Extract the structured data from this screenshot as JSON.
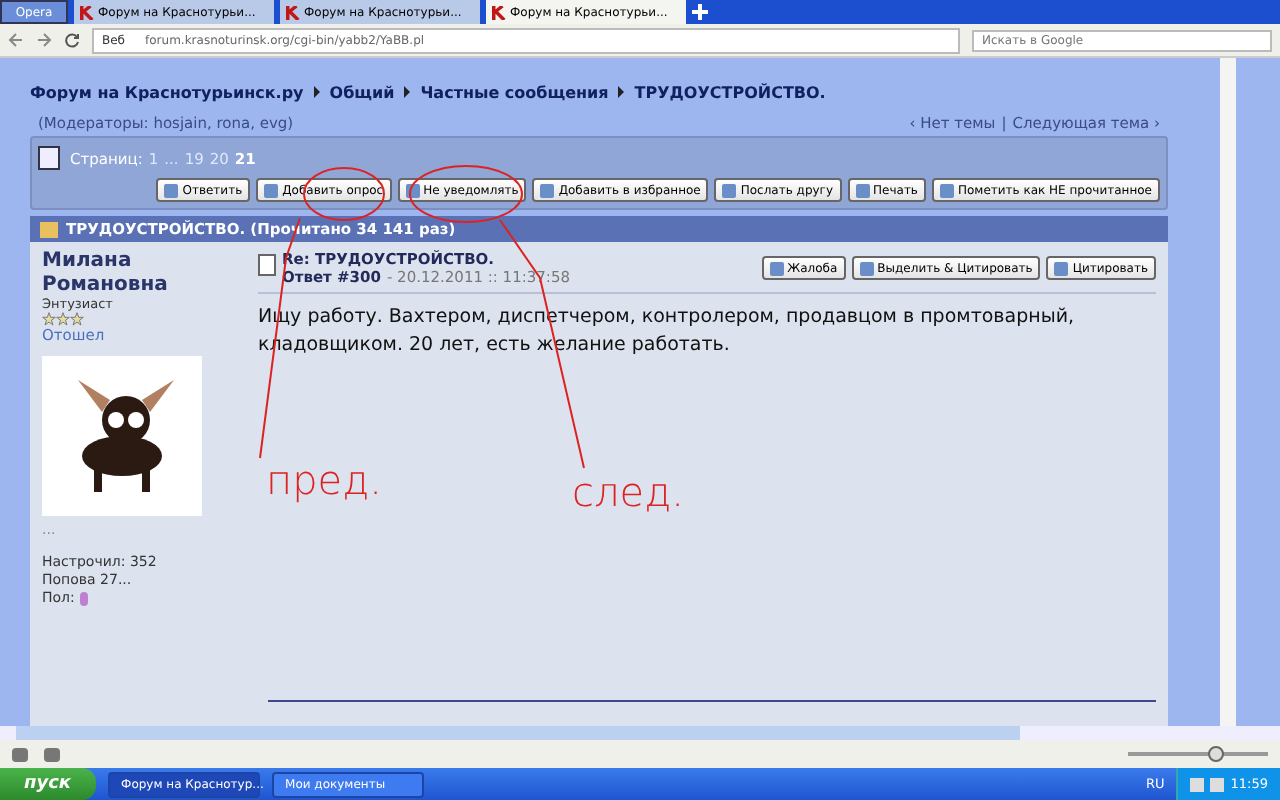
{
  "browser": {
    "app_button": "Opera",
    "tabs": [
      {
        "label": "Форум на Краснотурьи...",
        "selected": false
      },
      {
        "label": "Форум на Краснотурьи...",
        "selected": false
      },
      {
        "label": "Форум на Краснотурьи...",
        "selected": true
      }
    ],
    "address": {
      "prefix": "Веб",
      "url": "forum.krasnoturinsk.org/cgi-bin/yabb2/YaBB.pl"
    },
    "search": {
      "placeholder": "Искать в Google"
    }
  },
  "page": {
    "breadcrumbs": [
      "Форум на Краснотурьинск.ру",
      "Общий",
      "Частные сообщения",
      "ТРУДОУСТРОЙСТВО."
    ],
    "moderators": "(Модераторы: hosjain, rona, evg)",
    "topic_nav": [
      {
        "label": "‹ Нет темы"
      },
      {
        "label": "Следующая тема ›"
      }
    ],
    "topic_nav_separator": "|",
    "pages": {
      "label": "Страниц:",
      "items": [
        {
          "label": "1",
          "selected": false
        },
        {
          "label": "...",
          "selected": false
        },
        {
          "label": "19",
          "selected": false
        },
        {
          "label": "20",
          "selected": false
        },
        {
          "label": "21",
          "selected": true
        }
      ]
    },
    "toolbar": [
      "Ответить",
      "Добавить опрос",
      "Не уведомлять",
      "Добавить в избранное",
      "Послать другу",
      "Печать",
      "Пометить как НЕ прочитанное"
    ],
    "topic_header": "ТРУДОУСТРОЙСТВО. (Прочитано 34 141 раз)",
    "post": {
      "author": {
        "name": "Милана Романовна",
        "rank": "Энтузиаст",
        "stars": 3,
        "status": "Отошел",
        "ellipsis": "...",
        "stats": [
          "Настрочил: 352",
          "Попова 27..."
        ],
        "gender_label": "Пол:"
      },
      "title": "Re: ТРУДОУСТРОЙСТВО.",
      "reply": "Ответ #300",
      "date": "- 20.12.2011 :: 11:37:58",
      "actions": [
        "Жалоба",
        "Выделить & Цитировать",
        "Цитировать"
      ],
      "body": "Ищу работу. Вахтером, диспетчером, контролером, продавцом в промтоварный, кладовщиком. 20 лет, есть желание работать."
    }
  },
  "annotations": [
    "пред.",
    "след."
  ],
  "status_bar": {
    "zoom": {
      "level": 0.62
    }
  },
  "taskbar": {
    "start": "пуск",
    "tasks": [
      {
        "label": "Форум на Краснотур...",
        "selected": true
      },
      {
        "label": "Мои документы",
        "selected": false
      }
    ],
    "language": "RU",
    "clock": "11:59"
  }
}
